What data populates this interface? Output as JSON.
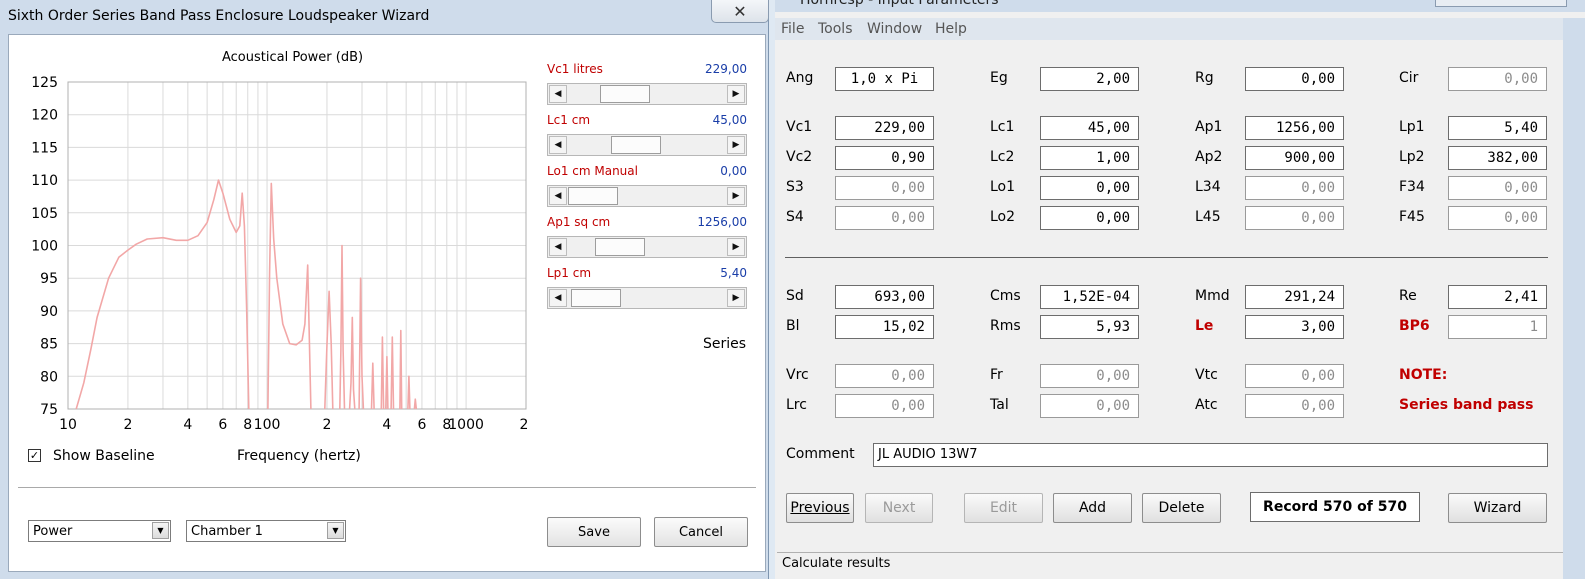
{
  "wizard": {
    "title": "Sixth Order Series Band Pass Enclosure Loudspeaker Wizard",
    "close_glyph": "✕",
    "chart_title": "Acoustical Power (dB)",
    "x_axis_label": "Frequency (hertz)",
    "show_baseline_label": "Show Baseline",
    "show_baseline_checked": true,
    "sliders": [
      {
        "label": "Vc1  litres",
        "value": "229,00",
        "position": 0.3
      },
      {
        "label": "Lc1  cm",
        "value": "45,00",
        "position": 0.4
      },
      {
        "label": "Lo1  cm  Manual",
        "value": "0,00",
        "position": 0.0
      },
      {
        "label": "Ap1  sq cm",
        "value": "1256,00",
        "position": 0.25
      },
      {
        "label": "Lp1  cm",
        "value": "5,40",
        "position": 0.03
      }
    ],
    "mode_label": "Series",
    "combo_view": "Power",
    "combo_chamber": "Chamber 1",
    "save_label": "Save",
    "cancel_label": "Cancel"
  },
  "chart_data": {
    "type": "line",
    "title": "Acoustical Power (dB)",
    "xlabel": "Frequency (hertz)",
    "ylabel": "",
    "x_scale": "log",
    "xlim": [
      10,
      2000
    ],
    "ylim": [
      75,
      125
    ],
    "y_ticks": [
      "125",
      "120",
      "115",
      "110",
      "105",
      "100",
      "95",
      "90",
      "85",
      "80",
      "75"
    ],
    "x_ticks": [
      "10",
      "2",
      "4",
      "6",
      "8",
      "100",
      "2",
      "4",
      "6",
      "8",
      "1000",
      "2"
    ],
    "grid": true,
    "series": [
      {
        "color": "#f2a7a7",
        "points": [
          [
            11,
            75
          ],
          [
            12,
            79
          ],
          [
            13,
            84
          ],
          [
            14,
            89
          ],
          [
            16,
            95
          ],
          [
            18,
            98.2
          ],
          [
            20,
            99.3
          ],
          [
            22,
            100.2
          ],
          [
            25,
            101
          ],
          [
            30,
            101.2
          ],
          [
            35,
            100.8
          ],
          [
            40,
            100.8
          ],
          [
            45,
            101.5
          ],
          [
            50,
            103.5
          ],
          [
            54,
            107
          ],
          [
            57,
            110
          ],
          [
            60,
            108
          ],
          [
            65,
            104
          ],
          [
            70,
            102
          ],
          [
            73,
            103
          ],
          [
            75,
            108
          ],
          [
            77,
            103
          ],
          [
            79,
            90
          ],
          [
            81,
            75
          ],
          [
            101,
            75
          ],
          [
            103,
            96
          ],
          [
            105,
            109.5
          ],
          [
            108,
            101
          ],
          [
            112,
            95
          ],
          [
            120,
            88
          ],
          [
            130,
            85
          ],
          [
            140,
            84.8
          ],
          [
            150,
            85.5
          ],
          [
            155,
            88
          ],
          [
            160,
            97
          ],
          [
            163,
            86
          ],
          [
            166,
            75
          ],
          [
            195,
            75
          ],
          [
            200,
            85
          ],
          [
            205,
            93
          ],
          [
            210,
            85
          ],
          [
            214,
            75
          ],
          [
            232,
            75
          ],
          [
            235,
            84
          ],
          [
            238,
            100
          ],
          [
            241,
            84
          ],
          [
            245,
            75
          ],
          [
            260,
            75
          ],
          [
            264,
            79
          ],
          [
            268,
            89
          ],
          [
            272,
            78
          ],
          [
            276,
            75
          ],
          [
            290,
            75
          ],
          [
            295,
            95
          ],
          [
            300,
            80
          ],
          [
            305,
            75
          ],
          [
            335,
            75
          ],
          [
            340,
            82
          ],
          [
            345,
            75
          ],
          [
            375,
            75
          ],
          [
            380,
            86
          ],
          [
            385,
            75
          ],
          [
            395,
            75
          ],
          [
            400,
            83
          ],
          [
            405,
            75
          ],
          [
            420,
            75
          ],
          [
            426,
            86
          ],
          [
            432,
            75
          ],
          [
            465,
            75
          ],
          [
            470,
            87
          ],
          [
            475,
            75
          ],
          [
            510,
            75
          ],
          [
            516,
            80
          ],
          [
            522,
            75
          ],
          [
            550,
            75
          ],
          [
            556,
            76.5
          ],
          [
            562,
            75
          ]
        ]
      }
    ]
  },
  "hornresp": {
    "title": "Hornresp - Input Parameters",
    "menu": [
      "File",
      "Tools",
      "Window",
      "Help"
    ],
    "rows": [
      [
        {
          "label": "Ang",
          "value": "1,0 x Pi",
          "disabled": false,
          "ang": true
        },
        {
          "label": "Eg",
          "value": "2,00",
          "disabled": false
        },
        {
          "label": "Rg",
          "value": "0,00",
          "disabled": false
        },
        {
          "label": "Cir",
          "value": "0,00",
          "disabled": true
        }
      ],
      [
        {
          "label": "Vc1",
          "value": "229,00",
          "disabled": false
        },
        {
          "label": "Lc1",
          "value": "45,00",
          "disabled": false
        },
        {
          "label": "Ap1",
          "value": "1256,00",
          "disabled": false
        },
        {
          "label": "Lp1",
          "value": "5,40",
          "disabled": false
        }
      ],
      [
        {
          "label": "Vc2",
          "value": "0,90",
          "disabled": false
        },
        {
          "label": "Lc2",
          "value": "1,00",
          "disabled": false
        },
        {
          "label": "Ap2",
          "value": "900,00",
          "disabled": false
        },
        {
          "label": "Lp2",
          "value": "382,00",
          "disabled": false
        }
      ],
      [
        {
          "label": "S3",
          "value": "0,00",
          "disabled": true
        },
        {
          "label": "Lo1",
          "value": "0,00",
          "disabled": false
        },
        {
          "label": "L34",
          "value": "0,00",
          "disabled": true
        },
        {
          "label": "F34",
          "value": "0,00",
          "disabled": true
        }
      ],
      [
        {
          "label": "S4",
          "value": "0,00",
          "disabled": true
        },
        {
          "label": "Lo2",
          "value": "0,00",
          "disabled": false
        },
        {
          "label": "L45",
          "value": "0,00",
          "disabled": true
        },
        {
          "label": "F45",
          "value": "0,00",
          "disabled": true
        }
      ],
      [
        {
          "label": "Sd",
          "value": "693,00",
          "disabled": false
        },
        {
          "label": "Cms",
          "value": "1,52E-04",
          "disabled": false
        },
        {
          "label": "Mmd",
          "value": "291,24",
          "disabled": false
        },
        {
          "label": "Re",
          "value": "2,41",
          "disabled": false
        }
      ],
      [
        {
          "label": "Bl",
          "value": "15,02",
          "disabled": false
        },
        {
          "label": "Rms",
          "value": "5,93",
          "disabled": false
        },
        {
          "label": "Le",
          "value": "3,00",
          "disabled": false,
          "red": true
        },
        {
          "label": "BP6",
          "value": "1",
          "disabled": true,
          "red": true
        }
      ],
      [
        {
          "label": "Vrc",
          "value": "0,00",
          "disabled": true
        },
        {
          "label": "Fr",
          "value": "0,00",
          "disabled": true
        },
        {
          "label": "Vtc",
          "value": "0,00",
          "disabled": true
        },
        {
          "label": "NOTE:",
          "value": null,
          "red": true
        }
      ],
      [
        {
          "label": "Lrc",
          "value": "0,00",
          "disabled": true
        },
        {
          "label": "Tal",
          "value": "0,00",
          "disabled": true
        },
        {
          "label": "Atc",
          "value": "0,00",
          "disabled": true
        },
        {
          "label": "Series band pass",
          "value": null,
          "red": true
        }
      ]
    ],
    "comment_label": "Comment",
    "comment_value": "JL AUDIO 13W7",
    "buttons": {
      "previous": "Previous",
      "next": "Next",
      "edit": "Edit",
      "add": "Add",
      "delete": "Delete",
      "wizard": "Wizard"
    },
    "record_text": "Record 570 of 570",
    "status": "Calculate results"
  }
}
